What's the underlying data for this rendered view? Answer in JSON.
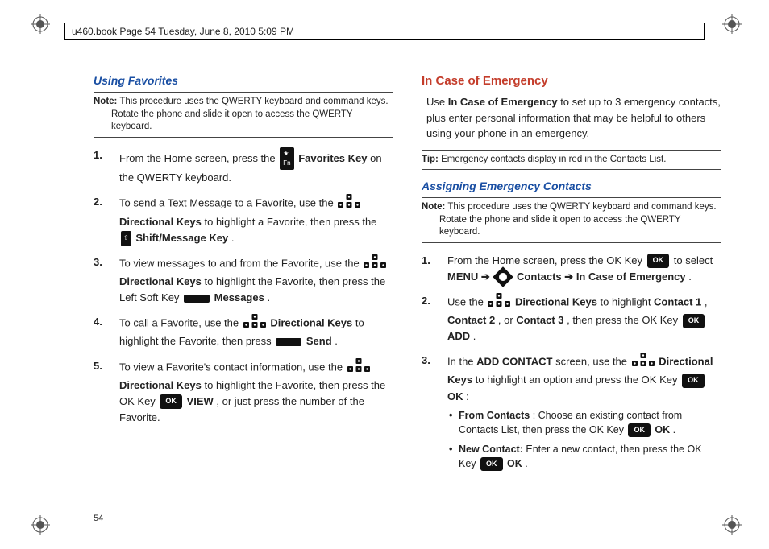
{
  "header": {
    "meta_line": "u460.book  Page 54  Tuesday, June 8, 2010  5:09 PM"
  },
  "left_column": {
    "heading": "Using Favorites",
    "note_label": "Note:",
    "note_text": " This procedure uses the QWERTY keyboard and command keys. Rotate the phone and slide it open to access the QWERTY keyboard.",
    "steps": [
      {
        "num": "1.",
        "pre": "From the Home screen, press the ",
        "bold1": "Favorites Key",
        "post": " on the QWERTY keyboard."
      },
      {
        "num": "2.",
        "pre": "To send a Text Message to a Favorite, use the ",
        "bold1": "Directional Keys",
        "mid": " to highlight a Favorite, then press the ",
        "bold2": "Shift/Message Key",
        "post": "."
      },
      {
        "num": "3.",
        "pre": "To view messages to and from the Favorite, use the ",
        "bold1": "Directional Keys",
        "mid": " to highlight the Favorite, then press the Left Soft Key ",
        "bold2": "Messages",
        "post": "."
      },
      {
        "num": "4.",
        "pre": "To call a Favorite, use the ",
        "bold1": "Directional Keys",
        "mid": " to highlight the Favorite, then press ",
        "bold2": "Send",
        "post": "."
      },
      {
        "num": "5.",
        "pre": "To view a Favorite's contact information, use the ",
        "bold1": "Directional Keys",
        "mid": " to highlight the Favorite, then press the OK Key ",
        "bold2": "VIEW",
        "post": ", or just press the number of the Favorite."
      }
    ]
  },
  "right_column": {
    "heading": "In Case of Emergency",
    "intro_pre": "Use ",
    "intro_bold": "In Case of Emergency",
    "intro_post": " to set up to 3 emergency contacts, plus enter personal information that may be helpful to others using your phone in an emergency.",
    "tip_label": "Tip:",
    "tip_text": " Emergency contacts display in red in the Contacts List.",
    "sub_heading": "Assigning Emergency Contacts",
    "note_label": "Note:",
    "note_text": " This procedure uses the QWERTY keyboard and command keys. Rotate the phone and slide it open to access the QWERTY keyboard.",
    "steps": [
      {
        "num": "1.",
        "pre": "From the Home screen, press the OK Key ",
        "mid1": " to select ",
        "bold1": "MENU",
        "arrow1": "  ➔  ",
        "bold2": "Contacts",
        "arrow2": "  ➔ ",
        "bold3": "In Case of Emergency",
        "post": "."
      },
      {
        "num": "2.",
        "pre": "Use the ",
        "bold1": "Directional Keys",
        "mid": " to highlight ",
        "bold_c1": "Contact 1",
        "comma1": ", ",
        "bold_c2": "Contact 2",
        "comma2": ", or ",
        "bold_c3": "Contact 3",
        "mid2": ", then press the OK Key ",
        "bold2": "ADD",
        "post": "."
      },
      {
        "num": "3.",
        "pre": "In the ",
        "bold1": "ADD CONTACT",
        "mid": " screen, use the ",
        "bold2": "Directional Keys",
        "mid2": " to highlight an option and press the OK Key ",
        "bold3": "OK",
        "post": ":"
      }
    ],
    "bullets": [
      {
        "bold": "From Contacts",
        "text": ": Choose an existing contact from Contacts List, then press the OK Key ",
        "bold2": "OK",
        "post": "."
      },
      {
        "bold": "New Contact:",
        "text": "  Enter a new contact, then press the OK Key ",
        "bold2": "OK",
        "post": "."
      }
    ]
  },
  "page_number": "54"
}
